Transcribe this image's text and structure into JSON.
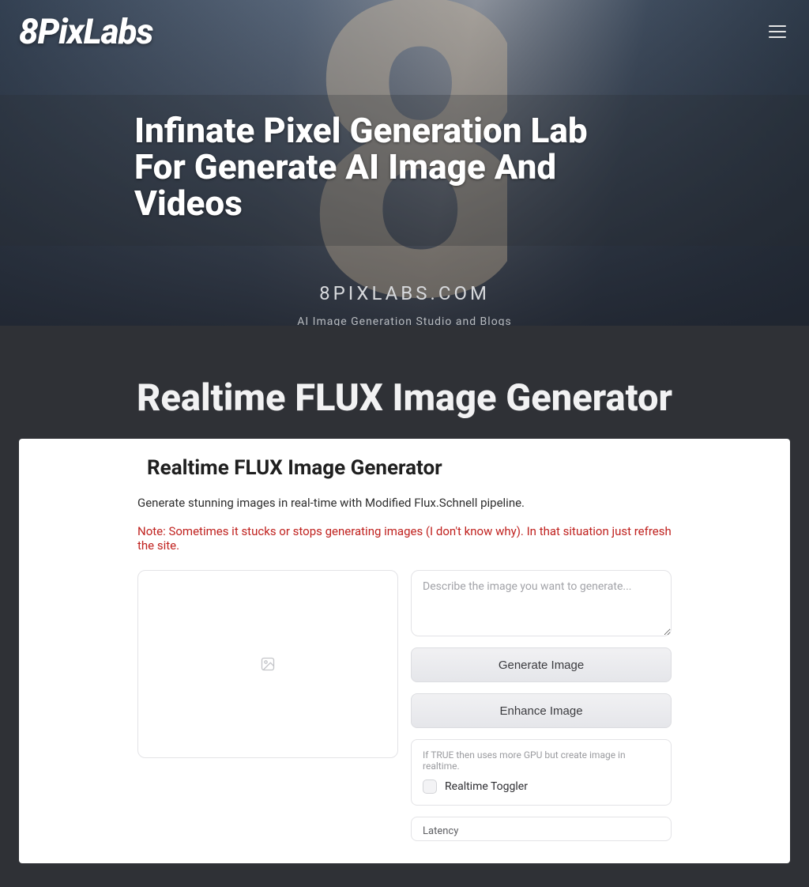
{
  "header": {
    "logo_text": "8PixLabs"
  },
  "hero": {
    "headline": "Infinate Pixel Generation Lab For Generate AI Image And Videos",
    "brand_sub": "8PIXLABS.COM",
    "tagline": "AI   Image Generation Studio and Blogs"
  },
  "section": {
    "title": "Realtime FLUX Image Generator"
  },
  "generator": {
    "heading": "Realtime FLUX Image Generator",
    "description": "Generate stunning images in real-time with Modified Flux.Schnell pipeline.",
    "note": "Note: Sometimes it stucks or stops generating images (I don't know why). In that situation just refresh the site.",
    "prompt_placeholder": "Describe the image you want to generate...",
    "generate_label": "Generate Image",
    "enhance_label": "Enhance Image",
    "realtime_hint": "If TRUE then uses more GPU but create image in realtime.",
    "realtime_label": "Realtime Toggler",
    "latency_label": "Latency"
  }
}
